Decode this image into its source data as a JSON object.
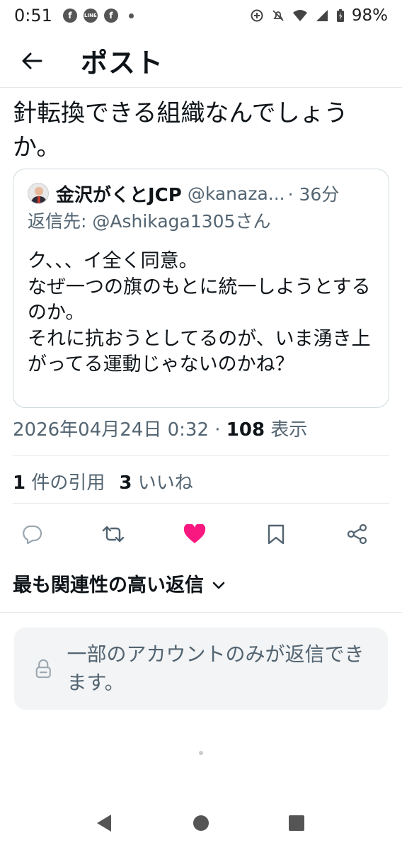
{
  "status_bar": {
    "time": "0:51",
    "battery": "98%",
    "notification_icons": [
      "facebook-icon",
      "line-icon",
      "facebook-icon"
    ]
  },
  "header": {
    "title": "ポスト"
  },
  "post": {
    "text": "針転換できる組織なんでしょうか。",
    "timestamp": "2026年04月24日 0:32",
    "views_count": "108",
    "views_label": "表示"
  },
  "quote": {
    "name": "金沢がくとJCP",
    "handle": "@kanaza...",
    "time": "· 36分",
    "reply_to": "返信先: @Ashikaga1305さん",
    "body": "ク、、、イ全く同意。\nなぜ一つの旗のもとに統一しようとするのか。\nそれに抗おうとしてるのが、いま湧き上がってる運動じゃないのかね？"
  },
  "engagement": {
    "quotes_count": "1",
    "quotes_label": "件の引用",
    "likes_count": "3",
    "likes_label": "いいね"
  },
  "actions": [
    "reply-icon",
    "retweet-icon",
    "like-icon",
    "bookmark-icon",
    "share-icon"
  ],
  "colors": {
    "like": "#f91880",
    "secondary_text": "#536471"
  },
  "replies": {
    "sort_label": "最も関連性の高い返信",
    "restricted_text": "一部のアカウントのみが返信できます。"
  }
}
